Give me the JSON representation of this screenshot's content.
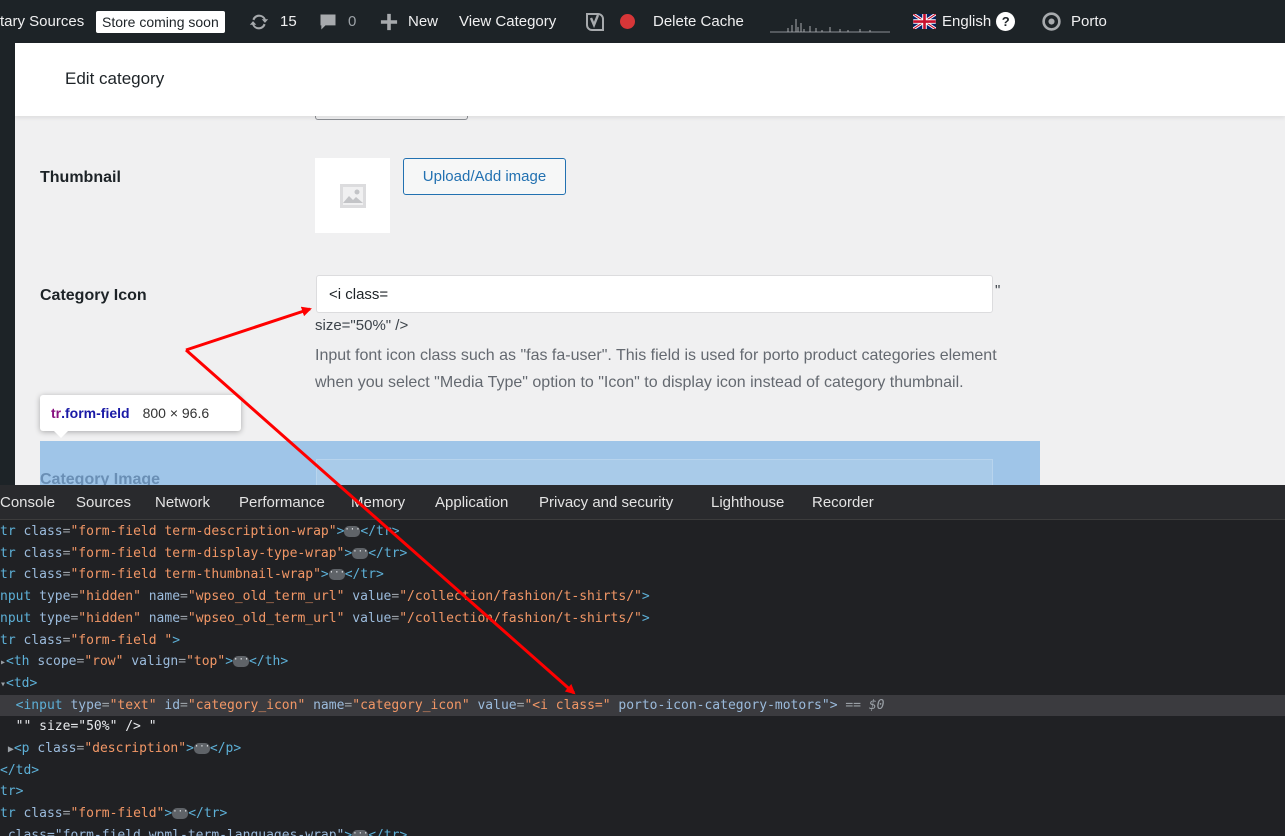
{
  "adminbar": {
    "sources_label": "tary Sources",
    "store_badge": "Store coming soon",
    "updates_count": "15",
    "comments_count": "0",
    "new_label": "New",
    "view_category": "View Category",
    "delete_cache": "Delete Cache",
    "language": "English",
    "help": "?",
    "theme": "Porto"
  },
  "header": {
    "title": "Edit category"
  },
  "form": {
    "thumbnail_label": "Thumbnail",
    "upload_button": "Upload/Add image",
    "category_icon_label": "Category Icon",
    "category_icon_value": "<i class=",
    "quote_after": "\"",
    "size_text": "size=\"50%\" />",
    "description": "Input font icon class such as \"fas fa-user\". This field is used for porto product categories element when you select \"Media Type\" option to \"Icon\" to display icon instead of category thumbnail.",
    "category_image_label": "Category Image"
  },
  "tooltip": {
    "tag": "tr",
    "class": ".form-field",
    "dims": "800 × 96.6"
  },
  "devtools": {
    "tabs": [
      "Console",
      "Sources",
      "Network",
      "Performance",
      "Memory",
      "Application",
      "Privacy and security",
      "Lighthouse",
      "Recorder"
    ],
    "lines": {
      "l1": {
        "prefix": "tr",
        "class": "\"form-field term-description-wrap\""
      },
      "l2": {
        "prefix": "tr",
        "class": "\"form-field term-display-type-wrap\""
      },
      "l3": {
        "prefix": "tr",
        "class": "\"form-field term-thumbnail-wrap\""
      },
      "l4": {
        "prefix": "nput",
        "type": "\"hidden\"",
        "name": "\"wpseo_old_term_url\"",
        "value": "\"/collection/fashion/t-shirts/\""
      },
      "l5": {
        "prefix": "nput",
        "type": "\"hidden\"",
        "name": "\"wpseo_old_term_url\"",
        "value": "\"/collection/fashion/t-shirts/\""
      },
      "l6": {
        "prefix": "tr",
        "class": "\"form-field \""
      },
      "l7": {
        "scope": "\"row\"",
        "valign": "\"top\""
      },
      "l8": {
        "text": "<td>"
      },
      "l9": {
        "type": "\"text\"",
        "id": "\"category_icon\"",
        "name": "\"category_icon\"",
        "value": "\"<i class=\"",
        "rest": " porto-icon-category-motors\">",
        "eq": " == $0"
      },
      "l10": {
        "text": " \"\" size=\"50%\" /> \""
      },
      "l11": {
        "class": "\"description\""
      },
      "l12": {
        "text": "</td>"
      },
      "l13": {
        "text": "tr>"
      },
      "l14": {
        "prefix": "tr",
        "class": "\"form-field\""
      },
      "l15": {
        "prefix": "class=\"form-field wpml-term-languages-wrap\""
      }
    }
  }
}
